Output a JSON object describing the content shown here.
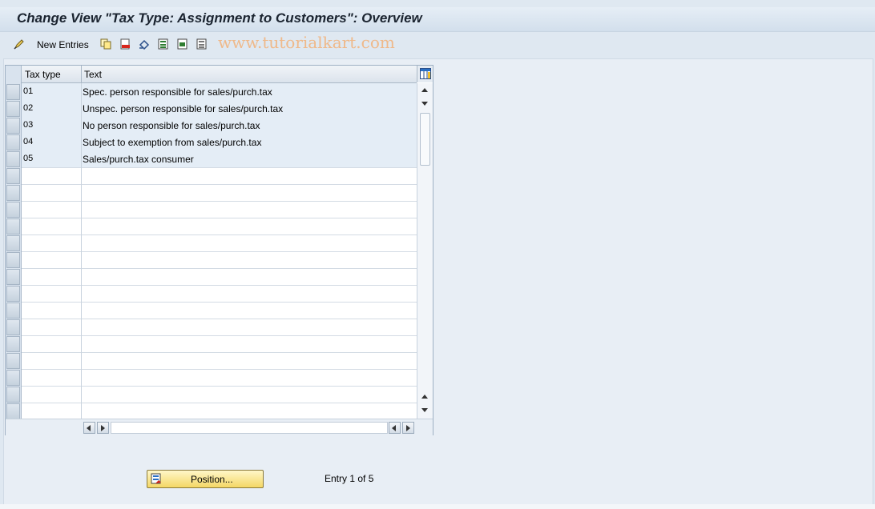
{
  "window": {
    "title": "Change View \"Tax Type: Assignment to Customers\": Overview"
  },
  "toolbar": {
    "new_entries_label": "New Entries",
    "icons": [
      "change-display-icon",
      "copy-icon",
      "delete-icon",
      "undo-icon",
      "select-all-icon",
      "select-block-icon",
      "deselect-all-icon"
    ]
  },
  "watermark": "www.tutorialkart.com",
  "table": {
    "columns": [
      "Tax type",
      "Text"
    ],
    "rows": [
      {
        "tax_type": "01",
        "text": "Spec. person responsible for sales/purch.tax"
      },
      {
        "tax_type": "02",
        "text": "Unspec. person responsible for sales/purch.tax"
      },
      {
        "tax_type": "03",
        "text": "No person responsible for sales/purch.tax"
      },
      {
        "tax_type": "04",
        "text": "Subject to exemption from sales/purch.tax"
      },
      {
        "tax_type": "05",
        "text": "Sales/purch.tax consumer"
      }
    ]
  },
  "footer": {
    "position_button_label": "Position...",
    "entry_info": "Entry 1 of 5"
  },
  "colors": {
    "background": "#dfe8f1",
    "position_button": "#f4d765",
    "row_fill": "#e4edf6"
  }
}
